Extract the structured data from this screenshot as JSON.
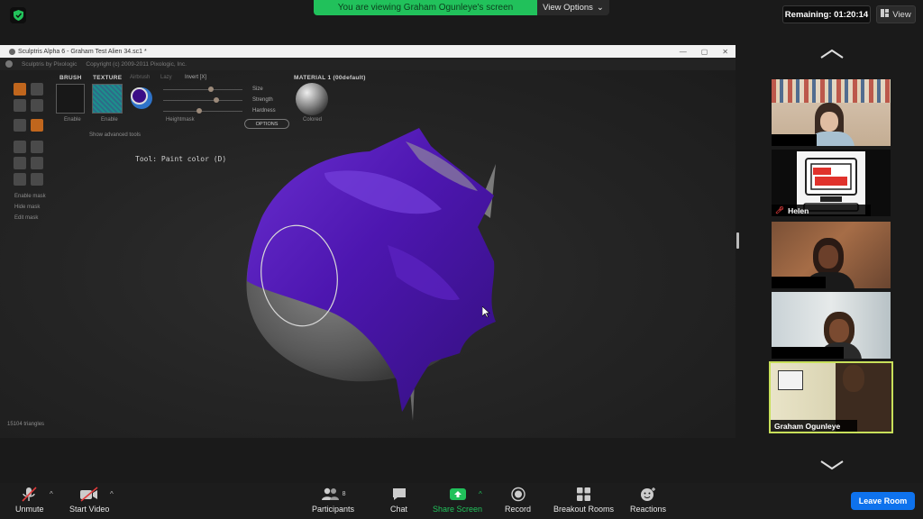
{
  "meeting": {
    "banner": "You are viewing Graham Ogunleye's screen",
    "view_options": "View Options",
    "remaining": "Remaining: 01:20:14",
    "view_label": "View"
  },
  "shared_window": {
    "title": "Sculptris Alpha 6 - Graham Test Alien 34.sc1 *",
    "menu_items": [
      "Sculptris by Pixologic",
      "Copyright (c) 2009-2011 Pixologic, Inc."
    ],
    "brush_label": "BRUSH",
    "texture_label": "TEXTURE",
    "airbrush_label": "Airbrush",
    "lazy_label": "Lazy",
    "invert_label": "Invert [X]",
    "size_label": "Size",
    "strength_label": "Strength",
    "hardness_label": "Hardness",
    "options_label": "OPTIONS",
    "material_label": "MATERIAL 1 (00default)",
    "enable1": "Enable",
    "enable2": "Enable",
    "heightmask": "Heightmask",
    "colored": "Colored",
    "show_advanced": "Show advanced tools",
    "tool_status": "Tool: Paint color (D)",
    "enable_mask": "Enable mask",
    "hide_mask": "Hide mask",
    "edit_mask": "Edit mask",
    "triangles": "15104 triangles",
    "paint_color": "#4a13a6"
  },
  "participants": [
    {
      "name": ""
    },
    {
      "name": "Helen"
    },
    {
      "name": ""
    },
    {
      "name": ""
    },
    {
      "name": "Graham Ogunleye"
    }
  ],
  "toolbar": {
    "unmute": "Unmute",
    "start_video": "Start Video",
    "participants": "Participants",
    "participants_count": "8",
    "chat": "Chat",
    "share_screen": "Share Screen",
    "record": "Record",
    "breakout": "Breakout Rooms",
    "reactions": "Reactions",
    "leave": "Leave Room"
  },
  "colors": {
    "banner_green": "#21c15b",
    "leave_blue": "#0e72ed",
    "active_speaker": "#c8e05a"
  }
}
